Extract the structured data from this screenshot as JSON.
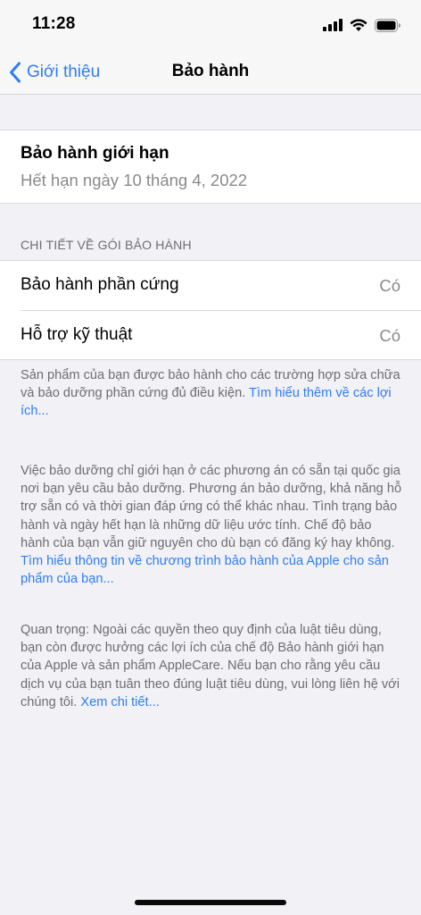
{
  "status_bar": {
    "time": "11:28"
  },
  "nav": {
    "back_label": "Giới thiệu",
    "title": "Bảo hành"
  },
  "limited_warranty": {
    "title": "Bảo hành giới hạn",
    "expiry": "Hết hạn ngày 10 tháng 4, 2022"
  },
  "details": {
    "header": "CHI TIẾT VỀ GÓI BẢO HÀNH",
    "rows": [
      {
        "label": "Bảo hành phần cứng",
        "value": "Có"
      },
      {
        "label": "Hỗ trợ kỹ thuật",
        "value": "Có"
      }
    ]
  },
  "footnotes": {
    "note1_text": "Sản phẩm của bạn được bảo hành cho các trường hợp sửa chữa và bảo dưỡng phần cứng đủ điều kiện. ",
    "note1_link": "Tìm hiểu thêm về các lợi ích...",
    "note2_text": "Việc bảo dưỡng chỉ giới hạn ở các phương án có sẵn tại quốc gia nơi bạn yêu cầu bảo dưỡng. Phương án bảo dưỡng, khả năng hỗ trợ sẵn có và thời gian đáp ứng có thể khác nhau. Tình trạng bảo hành và ngày hết hạn là những dữ liệu ước tính. Chế độ bảo hành của bạn vẫn giữ nguyên cho dù bạn có đăng ký hay không. ",
    "note2_link": "Tìm hiểu thông tin về chương trình bảo hành của Apple cho sản phẩm của bạn...",
    "note3_text": "Quan trọng: Ngoài các quyền theo quy định của luật tiêu dùng, bạn còn được hưởng các lợi ích của chế độ Bảo hành giới hạn của Apple và sản phẩm AppleCare. Nếu bạn cho rằng yêu cầu dịch vụ của bạn tuân theo đúng luật tiêu dùng, vui lòng liên hệ với chúng tôi. ",
    "note3_link": "Xem chi tiết..."
  },
  "colors": {
    "accent": "#2f7cf6",
    "background": "#f2f2f6",
    "secondary_text": "#8a8a8e"
  }
}
